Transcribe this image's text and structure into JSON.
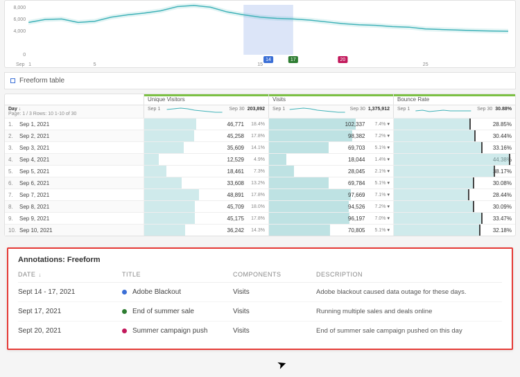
{
  "chart_data": {
    "type": "line",
    "title": "",
    "xlabel": "Sep",
    "ylabel": "",
    "y_ticks": [
      0,
      4000,
      6000,
      8000
    ],
    "x_ticks": [
      "1 Sep",
      "5",
      "15",
      "25"
    ],
    "x": [
      1,
      2,
      3,
      4,
      5,
      6,
      7,
      8,
      9,
      10,
      11,
      12,
      13,
      14,
      15,
      16,
      17,
      18,
      19,
      20,
      21,
      22,
      23,
      24,
      25,
      26,
      27,
      28,
      29,
      30
    ],
    "values": [
      5500,
      6000,
      6100,
      5500,
      5700,
      6400,
      6800,
      7100,
      7500,
      8200,
      8400,
      8100,
      7300,
      6800,
      6400,
      6200,
      6100,
      5900,
      5600,
      5300,
      5100,
      5000,
      4800,
      4700,
      4400,
      4300,
      4200,
      4100,
      4050,
      4000
    ],
    "annotation_markers": [
      {
        "x_start": 14,
        "x_end": 17,
        "label": "14",
        "color": "#3b6fd6"
      },
      {
        "x_start": 17,
        "x_end": 17,
        "label": "17",
        "color": "#2e7d32"
      },
      {
        "x_start": 20,
        "x_end": 20,
        "label": "20",
        "color": "#c2185b"
      }
    ]
  },
  "freeform_header": {
    "section_label": "Freeform table",
    "columns": [
      "Unique Visitors",
      "Visits",
      "Bounce Rate"
    ]
  },
  "freeform_sub": {
    "day_label": "Day",
    "page_label": "Page: 1 / 3   Rows: 10   1-10 of 30",
    "col_totals": [
      {
        "total": "203,892",
        "sub": "out of 203,892",
        "range_l": "Sep 1",
        "range_r": "Sep 30"
      },
      {
        "total": "1,375,912",
        "sub": "out of 1,375,912",
        "range_l": "Sep 1",
        "range_r": "Sep 30"
      },
      {
        "total": "30.88%",
        "sub": "out of 30.88%",
        "range_l": "Sep 1",
        "range_r": "Sep 30"
      }
    ]
  },
  "freeform_rows": [
    {
      "idx": "1.",
      "day": "Sep 1, 2021",
      "uv": "46,771",
      "uv_pct": "18.4%",
      "uv_w": 42,
      "v": "102,337",
      "v_pct": "7.4%",
      "v_w": 70,
      "b": "28.85%",
      "b_w": 62
    },
    {
      "idx": "2.",
      "day": "Sep 2, 2021",
      "uv": "45,258",
      "uv_pct": "17.8%",
      "uv_w": 40,
      "v": "98,382",
      "v_pct": "7.2%",
      "v_w": 67,
      "b": "30.44%",
      "b_w": 66
    },
    {
      "idx": "3.",
      "day": "Sep 3, 2021",
      "uv": "35,609",
      "uv_pct": "14.1%",
      "uv_w": 32,
      "v": "69,703",
      "v_pct": "5.1%",
      "v_w": 48,
      "b": "33.16%",
      "b_w": 72
    },
    {
      "idx": "4.",
      "day": "Sep 4, 2021",
      "uv": "12,529",
      "uv_pct": "4.9%",
      "uv_w": 12,
      "v": "18,044",
      "v_pct": "1.4%",
      "v_w": 14,
      "b": "44.38%",
      "b_w": 95
    },
    {
      "idx": "5.",
      "day": "Sep 5, 2021",
      "uv": "18,461",
      "uv_pct": "7.3%",
      "uv_w": 18,
      "v": "28,045",
      "v_pct": "2.1%",
      "v_w": 20,
      "b": "38.17%",
      "b_w": 82
    },
    {
      "idx": "6.",
      "day": "Sep 6, 2021",
      "uv": "33,608",
      "uv_pct": "13.2%",
      "uv_w": 30,
      "v": "69,784",
      "v_pct": "5.1%",
      "v_w": 48,
      "b": "30.08%",
      "b_w": 65
    },
    {
      "idx": "7.",
      "day": "Sep 7, 2021",
      "uv": "48,891",
      "uv_pct": "17.8%",
      "uv_w": 44,
      "v": "97,669",
      "v_pct": "7.1%",
      "v_w": 66,
      "b": "28.44%",
      "b_w": 61
    },
    {
      "idx": "8.",
      "day": "Sep 8, 2021",
      "uv": "45,709",
      "uv_pct": "18.0%",
      "uv_w": 41,
      "v": "94,526",
      "v_pct": "7.2%",
      "v_w": 64,
      "b": "30.09%",
      "b_w": 65
    },
    {
      "idx": "9.",
      "day": "Sep 9, 2021",
      "uv": "45,175",
      "uv_pct": "17.8%",
      "uv_w": 41,
      "v": "96,197",
      "v_pct": "7.0%",
      "v_w": 65,
      "b": "33.47%",
      "b_w": 72
    },
    {
      "idx": "10.",
      "day": "Sep 10, 2021",
      "uv": "36,242",
      "uv_pct": "14.3%",
      "uv_w": 33,
      "v": "70,805",
      "v_pct": "5.1%",
      "v_w": 49,
      "b": "32.18%",
      "b_w": 70
    }
  ],
  "annotations_panel": {
    "title": "Annotations: Freeform",
    "headers": {
      "date": "DATE",
      "title": "TITLE",
      "components": "COMPONENTS",
      "description": "DESCRIPTION"
    },
    "rows": [
      {
        "date": "Sept 14 - 17, 2021",
        "dot": "#3b6fd6",
        "title": "Adobe Blackout",
        "components": "Visits",
        "description": "Adobe blackout caused data outage for these days."
      },
      {
        "date": "Sept 17, 2021",
        "dot": "#2e7d32",
        "title": "End of summer sale",
        "components": "Visits",
        "description": "Running multiple sales and deals online"
      },
      {
        "date": "Sept 20, 2021",
        "dot": "#c2185b",
        "title": "Summer campaign push",
        "components": "Visits",
        "description": "End of summer sale campaign pushed on this day"
      }
    ]
  }
}
